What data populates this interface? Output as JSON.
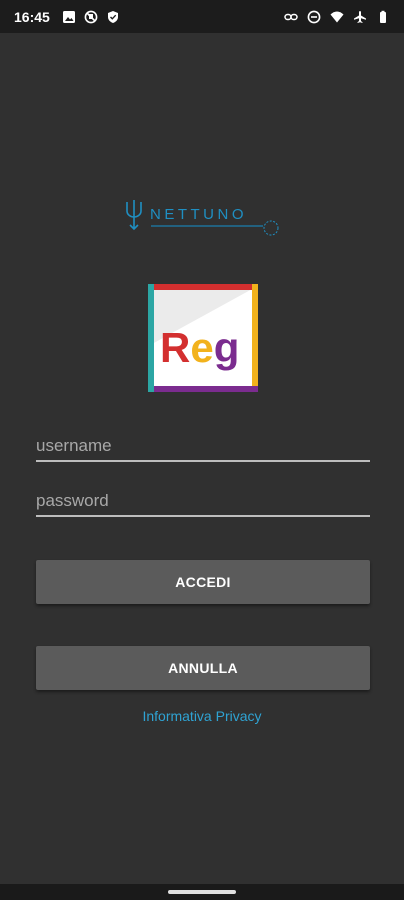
{
  "status_bar": {
    "time": "16:45",
    "icons_left": [
      "image-icon",
      "no-sim-icon",
      "shield-icon"
    ],
    "icons_right": [
      "link-icon",
      "dnd-icon",
      "wifi-icon",
      "airplane-icon",
      "battery-icon"
    ]
  },
  "branding": {
    "logo": "nettuno-logo",
    "logo_text": "NETTUNO",
    "app_icon_text": "Reg",
    "app_icon_colors": {
      "red": "#d32f2f",
      "yellow": "#f2b21c",
      "purple": "#7b2c8f",
      "teal": "#2ca6a4"
    }
  },
  "login_form": {
    "username_placeholder": "username",
    "username_value": "",
    "password_placeholder": "password",
    "password_value": ""
  },
  "buttons": {
    "login_label": "ACCEDI",
    "cancel_label": "ANNULLA"
  },
  "links": {
    "privacy_label": "Informativa Privacy"
  },
  "colors": {
    "background": "#303030",
    "button": "#5b5b5b",
    "link": "#2fa3d3"
  }
}
